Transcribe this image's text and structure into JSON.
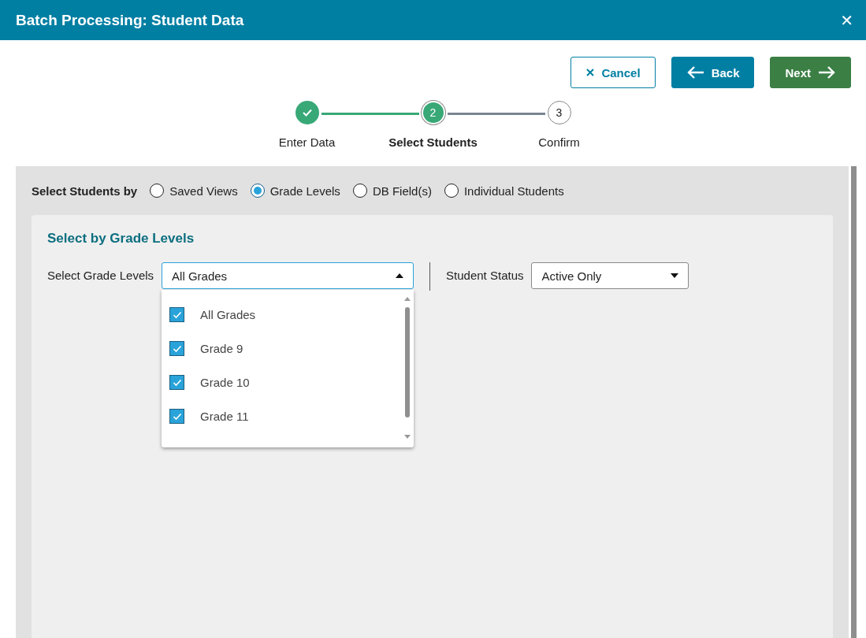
{
  "window": {
    "title": "Batch Processing: Student Data",
    "close": "✕"
  },
  "buttons": [
    {
      "kind": "cancel",
      "label": "Cancel"
    },
    {
      "kind": "back",
      "label": "Back"
    },
    {
      "kind": "next",
      "label": "Next"
    }
  ],
  "steps": [
    {
      "label": "Enter Data",
      "completed": true,
      "selected": false
    },
    {
      "label": "Select Students",
      "number": "2",
      "completed": false,
      "selected": true
    },
    {
      "label": "Confirm",
      "number": "3",
      "completed": false,
      "selected": false
    }
  ],
  "select_by": {
    "label": "Select Students by",
    "options": [
      {
        "label": "Saved Views",
        "selected": false
      },
      {
        "label": "Grade Levels",
        "selected": true
      },
      {
        "label": "DB Field(s)",
        "selected": false
      },
      {
        "label": "Individual Students",
        "selected": false
      }
    ]
  },
  "grade_panel": {
    "title": "Select by Grade Levels",
    "grade_label": "Select Grade Levels",
    "grade_value": "All Grades",
    "expanded": true,
    "grade_options": [
      {
        "label": "All Grades",
        "checked": true
      },
      {
        "label": "Grade 9",
        "checked": true
      },
      {
        "label": "Grade 10",
        "checked": true
      },
      {
        "label": "Grade 11",
        "checked": true
      }
    ],
    "status_label": "Student Status",
    "status_value": "Active Only"
  }
}
